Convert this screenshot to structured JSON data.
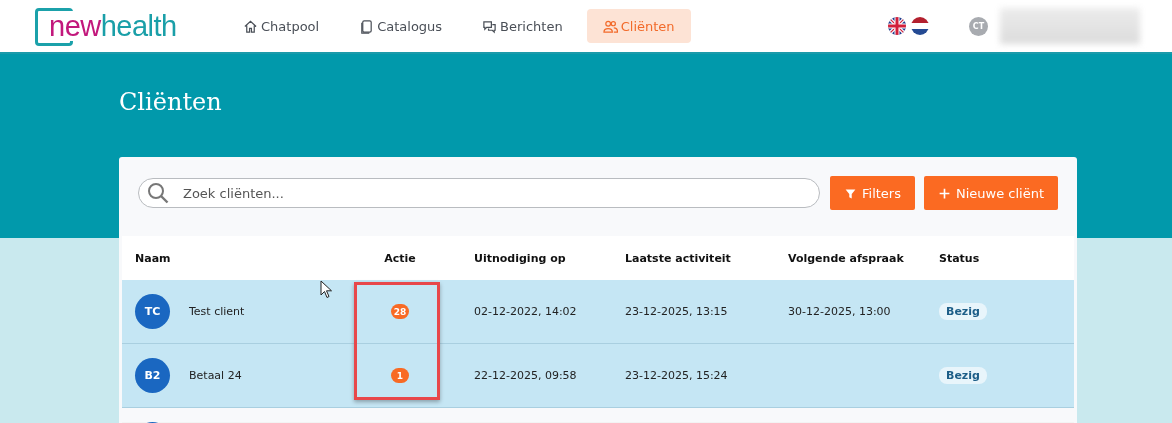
{
  "logo": {
    "first": "new",
    "second": "health"
  },
  "nav": [
    {
      "label": "Chatpool",
      "kind": "home",
      "selected": false
    },
    {
      "label": "Catalogus",
      "kind": "pages",
      "selected": false
    },
    {
      "label": "Berichten",
      "kind": "chat",
      "selected": false
    },
    {
      "label": "Cliënten",
      "kind": "users",
      "selected": true
    }
  ],
  "languages": [
    {
      "kind": "uk"
    },
    {
      "kind": "nl"
    }
  ],
  "user": {
    "initials": "CT"
  },
  "page_title": "Cliënten",
  "search": {
    "placeholder": "Zoek cliënten..."
  },
  "buttons": [
    {
      "label": "Filters",
      "kind": "filter"
    },
    {
      "label": "Nieuwe cliënt",
      "kind": "plus"
    }
  ],
  "table": {
    "columns": [
      "Naam",
      "Actie",
      "Uitnodiging op",
      "Laatste activiteit",
      "Volgende afspraak",
      "Status"
    ],
    "rows": [
      {
        "initials": "TC",
        "name": "Test client",
        "actions": "28",
        "invited": "02-12-2022, 14:02",
        "last_activity": "23-12-2025, 13:15",
        "next_appointment": "30-12-2025, 13:00",
        "status": "Bezig"
      },
      {
        "initials": "B2",
        "name": "Betaal 24",
        "actions": "1",
        "invited": "22-12-2025, 09:58",
        "last_activity": "23-12-2025, 15:24",
        "status": "Bezig"
      }
    ]
  }
}
